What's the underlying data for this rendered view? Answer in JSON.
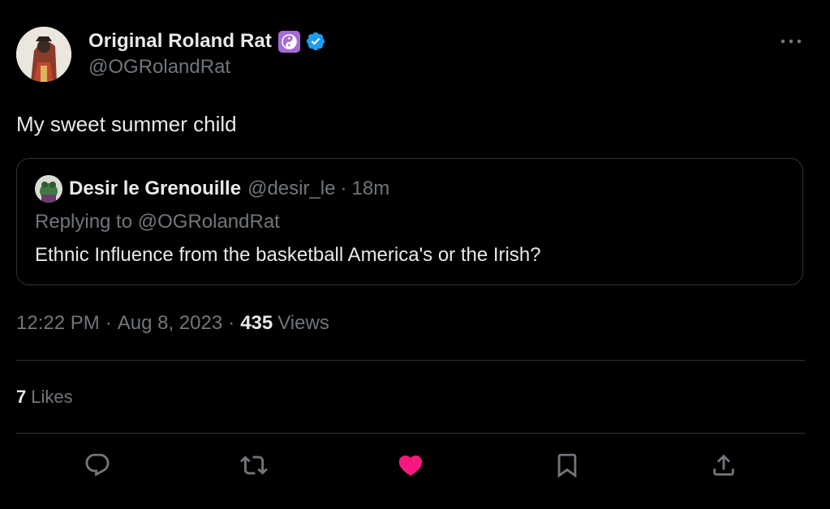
{
  "author": {
    "display_name": "Original Roland Rat",
    "handle": "@OGRolandRat",
    "badge_icon": "yin-yang-icon",
    "verified_icon": "verified-badge-icon"
  },
  "tweet": {
    "text": "My sweet summer child"
  },
  "quoted": {
    "display_name": "Desir le Grenouille",
    "handle": "@desir_le",
    "separator": "·",
    "time": "18m",
    "replying_prefix": "Replying to",
    "replying_handle": "@OGRolandRat",
    "text": "Ethnic Influence from the basketball America's or the Irish?"
  },
  "meta": {
    "time": "12:22 PM",
    "date": "Aug 8, 2023",
    "separator": "·",
    "views_count": "435",
    "views_label": "Views"
  },
  "likes": {
    "count": "7",
    "label": "Likes"
  },
  "colors": {
    "background": "#000000",
    "text": "#e7e9ea",
    "muted": "#71767b",
    "border": "#2f3336",
    "verified": "#1d9bf0",
    "like_active": "#f91880",
    "yin_yang_badge": "#a66bd6"
  },
  "actions": [
    {
      "name": "reply-icon"
    },
    {
      "name": "retweet-icon"
    },
    {
      "name": "like-icon"
    },
    {
      "name": "bookmark-icon"
    },
    {
      "name": "share-icon"
    }
  ]
}
